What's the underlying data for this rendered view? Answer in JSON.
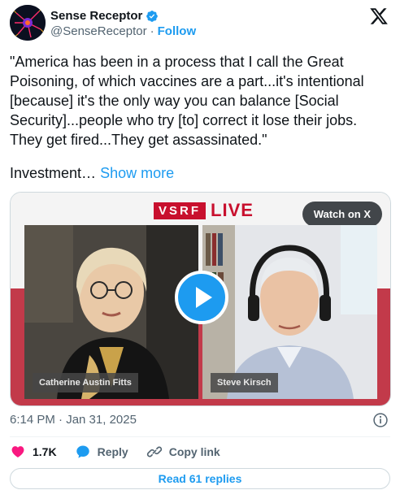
{
  "author": {
    "display_name": "Sense Receptor",
    "handle": "@SenseReceptor",
    "separator": "·",
    "follow_label": "Follow"
  },
  "tweet": {
    "text": "\"America has been in a process that I call the Great Poisoning, of which vaccines are a part...it's intentional [because] it's the only way you can balance [Social Security]...people who try [to] correct it lose their jobs. They get fired...They get assassinated.\"",
    "truncated_text": "Investment…",
    "show_more_label": "Show more"
  },
  "media": {
    "brand_box": "VSRF",
    "brand_live": "LIVE",
    "watch_label": "Watch on X",
    "left_speaker": "Catherine Austin Fitts",
    "right_speaker": "Steve Kirsch"
  },
  "meta": {
    "timestamp": "6:14 PM · Jan 31, 2025"
  },
  "actions": {
    "like_count": "1.7K",
    "reply_label": "Reply",
    "copy_label": "Copy link",
    "read_replies_label": "Read 61 replies"
  },
  "colors": {
    "accent": "#1d9bf0",
    "like": "#f91880",
    "brand_red": "#c8102e"
  }
}
